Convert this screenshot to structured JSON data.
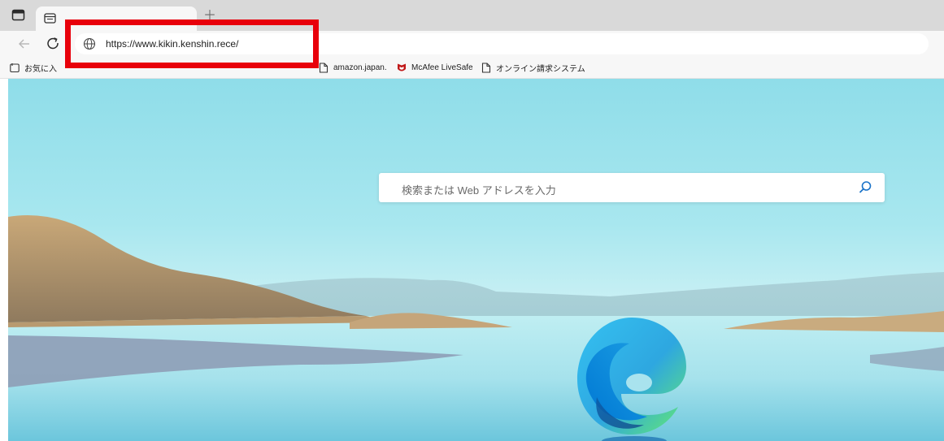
{
  "browser": {
    "tab": {
      "title": ""
    },
    "address_bar": {
      "url": "https://www.kikin.kenshin.rece/"
    }
  },
  "favorites": [
    {
      "label": "お気に入",
      "icon": "favorites-folder-icon"
    },
    {
      "label": "amazon.japan.",
      "icon": "page-icon"
    },
    {
      "label": "McAfee LiveSafe",
      "icon": "mcafee-icon"
    },
    {
      "label": "オンライン請求システム",
      "icon": "page-icon"
    }
  ],
  "new_tab_page": {
    "search_placeholder": "検索または Web アドレスを入力"
  },
  "colors": {
    "highlight": "#e8000b",
    "mcafee": "#c01818"
  }
}
